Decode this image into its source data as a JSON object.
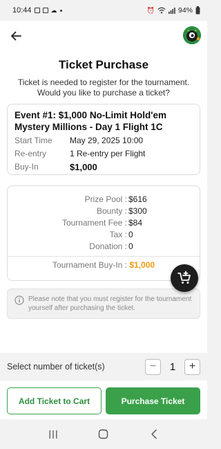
{
  "status_bar": {
    "time": "10:44",
    "battery": "94%",
    "icons": [
      "image-icon",
      "mail-icon",
      "cloud-icon",
      "dot-icon",
      "alarm-icon",
      "wifi-icon",
      "signal-icon",
      "battery-icon"
    ]
  },
  "header": {
    "back_icon": "arrow-left-icon",
    "avatar_icon": "monster-avatar-icon"
  },
  "page": {
    "title": "Ticket Purchase",
    "subtitle": "Ticket is needed to register for the tournament. Would you like to purchase a ticket?"
  },
  "event": {
    "title": "Event #1: $1,000 No-Limit Hold'em Mystery Millions - Day 1 Flight 1C",
    "rows": [
      {
        "label": "Start Time",
        "value": "May 29, 2025 10:00"
      },
      {
        "label": "Re-entry",
        "value": "1 Re-entry per Flight"
      },
      {
        "label": "Buy-In",
        "value": "$1,000"
      }
    ]
  },
  "fees": {
    "rows": [
      {
        "label": "Prize Pool :",
        "value": "$616"
      },
      {
        "label": "Bounty :",
        "value": "$300"
      },
      {
        "label": "Tournament Fee :",
        "value": "$84"
      },
      {
        "label": "Tax :",
        "value": "0"
      },
      {
        "label": "Donation :",
        "value": "0"
      }
    ],
    "total_label": "Tournament Buy-In :",
    "total_value": "$1,000"
  },
  "notice": {
    "icon": "info-icon",
    "text": "Please note that you must register for the tournament yourself after purchasing the ticket."
  },
  "fab": {
    "icon": "add-to-cart-icon"
  },
  "quantity": {
    "label": "Select number of ticket(s)",
    "value": "1",
    "minus": "−",
    "plus": "+"
  },
  "actions": {
    "add_to_cart": "Add Ticket to Cart",
    "purchase": "Purchase Ticket"
  },
  "colors": {
    "accent_green": "#3aa14a",
    "total_orange": "#f09a12",
    "fab_dark": "#1e1e1e"
  },
  "nav": {
    "icons": [
      "recent-apps-icon",
      "home-icon",
      "back-nav-icon"
    ]
  }
}
